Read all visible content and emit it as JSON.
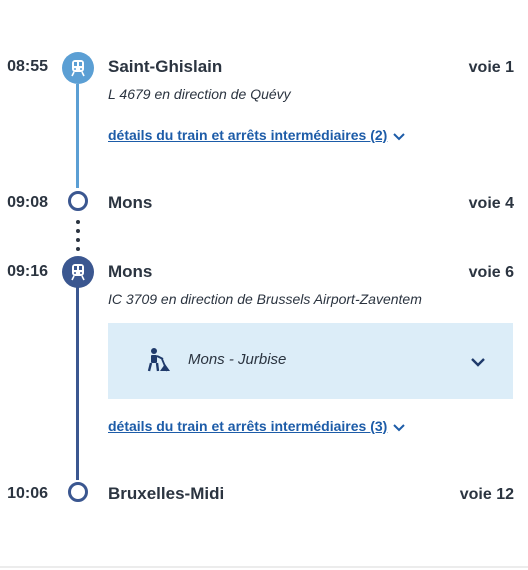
{
  "stops": [
    {
      "time": "08:55",
      "station": "Saint-Ghislain",
      "track": "voie 1"
    },
    {
      "time": "09:08",
      "station": "Mons",
      "track": "voie 4"
    },
    {
      "time": "09:16",
      "station": "Mons",
      "track": "voie 6"
    },
    {
      "time": "10:06",
      "station": "Bruxelles-Midi",
      "track": "voie 12"
    }
  ],
  "legs": [
    {
      "direction": "L 4679 en direction de Quévy",
      "details_link": "détails du train et arrêts intermédiaires (2)",
      "color": "#5b9fd4"
    },
    {
      "direction": "IC 3709 en direction de Brussels Airport-Zaventem",
      "details_link": "détails du train et arrêts intermédiaires (3)",
      "color": "#3b5790"
    }
  ],
  "works_notice": {
    "text": "Mons - Jurbise",
    "icon": "roadworks-icon"
  },
  "colors": {
    "local_train": "#5b9fd4",
    "ic_train": "#3b5790",
    "link": "#1d5ca8",
    "notice_bg": "#dcedf8"
  }
}
